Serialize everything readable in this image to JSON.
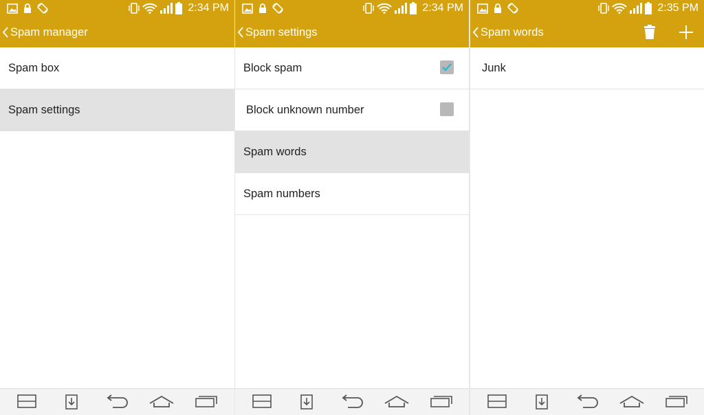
{
  "screens": [
    {
      "status": {
        "time": "2:34 PM"
      },
      "title": "Spam manager",
      "rows": [
        {
          "label": "Spam box"
        },
        {
          "label": "Spam settings"
        }
      ]
    },
    {
      "status": {
        "time": "2:34 PM"
      },
      "title": "Spam settings",
      "rows": [
        {
          "label": "Block spam",
          "checked": true
        },
        {
          "label": "Block unknown number",
          "checked": false
        },
        {
          "label": "Spam words"
        },
        {
          "label": "Spam numbers"
        }
      ]
    },
    {
      "status": {
        "time": "2:35 PM"
      },
      "title": "Spam words",
      "rows": [
        {
          "label": "Junk"
        }
      ],
      "actions": [
        "trash-icon",
        "add-icon"
      ]
    }
  ],
  "colors": {
    "accent": "#d4a20f",
    "selected_row": "#e2e2e2",
    "checkmark": "#2ab7d6"
  },
  "icons": [
    "image-icon",
    "lock-icon",
    "rotate-icon",
    "vibrate-icon",
    "wifi-icon",
    "signal-icon",
    "battery-icon",
    "back-chevron-icon",
    "dual-window-icon",
    "download-icon",
    "back-icon",
    "home-icon",
    "recent-apps-icon"
  ]
}
